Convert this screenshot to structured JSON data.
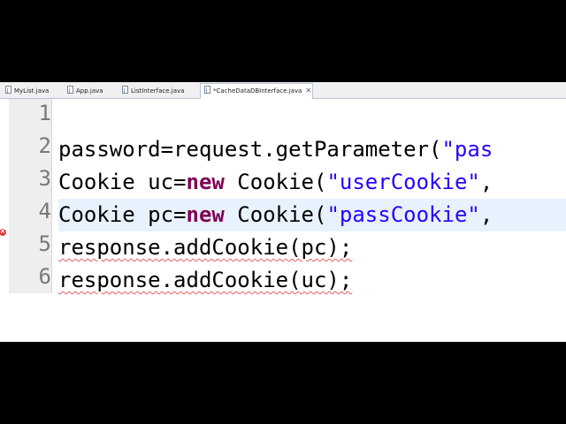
{
  "tabs": [
    {
      "label": "MyList.java",
      "active": false
    },
    {
      "label": "App.java",
      "active": false
    },
    {
      "label": "ListInterface.java",
      "active": false
    },
    {
      "label": "*CacheDataDBInterface.java",
      "active": true
    }
  ],
  "tab_close_glyph": "✕",
  "line_numbers": [
    "1",
    "2",
    "3",
    "4",
    "5",
    "6"
  ],
  "code": {
    "line2": {
      "ident": "password=request.getParameter(",
      "str": "\"pas"
    },
    "line3": {
      "a": "Cookie uc=",
      "kw": "new",
      "b": " Cookie(",
      "str": "\"userCookie\"",
      "tail": ","
    },
    "line4": {
      "a": "Cookie pc=",
      "kw": "new",
      "b": " Cookie(",
      "str": "\"passCookie\"",
      "tail": ","
    },
    "line5": {
      "text": "response.addCookie(pc);"
    },
    "line6": {
      "text": "response.addCookie(uc);"
    }
  },
  "markers": {
    "error_line": "4",
    "error_icon": "error-x-icon"
  },
  "colors": {
    "keyword": "#7f0055",
    "string": "#2a00ff",
    "current_line": "#e8f2fe",
    "error": "#e23b3b"
  }
}
